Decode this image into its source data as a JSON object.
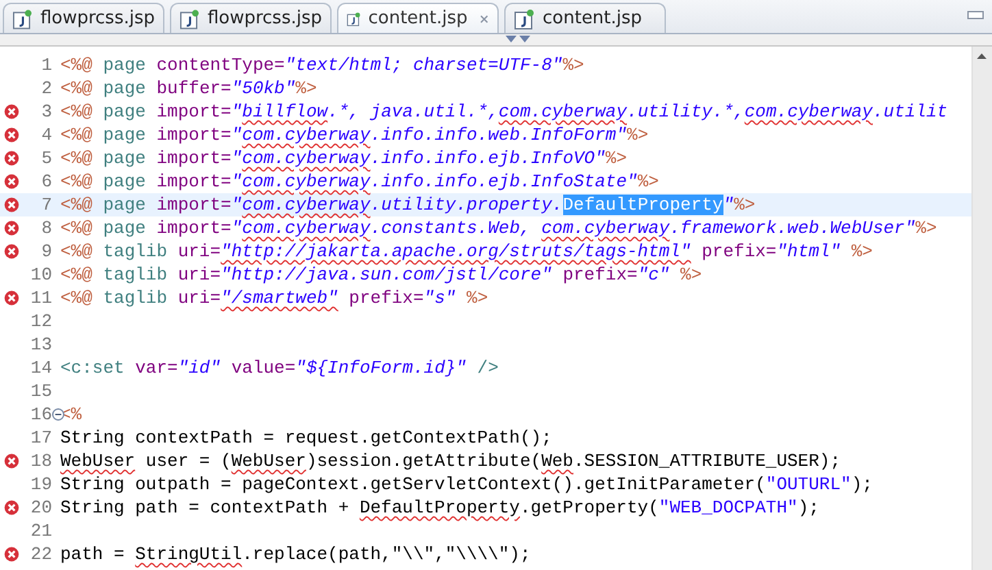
{
  "tabs": [
    {
      "label": "flowprcss.jsp",
      "selected": false
    },
    {
      "label": "flowprcss.jsp",
      "selected": false
    },
    {
      "label": "content.jsp",
      "selected": true
    },
    {
      "label": "content.jsp",
      "selected": false
    }
  ],
  "editor": {
    "lines": [
      {
        "number": "1",
        "error": false,
        "fold": false,
        "current": false,
        "tokens": [
          {
            "kind": "d",
            "text": "<%@ "
          },
          {
            "kind": "t",
            "text": "page "
          },
          {
            "kind": "a",
            "text": "contentType="
          },
          {
            "kind": "s",
            "text": "\"text/html; charset=UTF-8\""
          },
          {
            "kind": "d",
            "text": "%>"
          }
        ]
      },
      {
        "number": "2",
        "error": false,
        "fold": false,
        "current": false,
        "tokens": [
          {
            "kind": "d",
            "text": "<%@ "
          },
          {
            "kind": "t",
            "text": "page "
          },
          {
            "kind": "a",
            "text": "buffer="
          },
          {
            "kind": "s",
            "text": "\"50kb\""
          },
          {
            "kind": "d",
            "text": "%>"
          }
        ]
      },
      {
        "number": "3",
        "error": true,
        "fold": false,
        "current": false,
        "tokens": [
          {
            "kind": "d",
            "text": "<%@ "
          },
          {
            "kind": "t",
            "text": "page "
          },
          {
            "kind": "a",
            "text": "import="
          },
          {
            "kind": "s",
            "text": "\""
          },
          {
            "kind": "se",
            "text": "billflow"
          },
          {
            "kind": "s",
            "text": ".*, java.util.*,"
          },
          {
            "kind": "se",
            "text": "com.cyberway"
          },
          {
            "kind": "s",
            "text": ".utility.*,"
          },
          {
            "kind": "se",
            "text": "com.cyberway"
          },
          {
            "kind": "s",
            "text": ".utilit"
          }
        ]
      },
      {
        "number": "4",
        "error": true,
        "fold": false,
        "current": false,
        "tokens": [
          {
            "kind": "d",
            "text": "<%@ "
          },
          {
            "kind": "t",
            "text": "page "
          },
          {
            "kind": "a",
            "text": "import="
          },
          {
            "kind": "s",
            "text": "\""
          },
          {
            "kind": "se",
            "text": "com.cyberway"
          },
          {
            "kind": "s",
            "text": ".info.info.web.InfoForm\""
          },
          {
            "kind": "d",
            "text": "%>"
          }
        ]
      },
      {
        "number": "5",
        "error": true,
        "fold": false,
        "current": false,
        "tokens": [
          {
            "kind": "d",
            "text": "<%@ "
          },
          {
            "kind": "t",
            "text": "page "
          },
          {
            "kind": "a",
            "text": "import="
          },
          {
            "kind": "s",
            "text": "\""
          },
          {
            "kind": "se",
            "text": "com.cyberway"
          },
          {
            "kind": "s",
            "text": ".info.info.ejb.InfoVO\""
          },
          {
            "kind": "d",
            "text": "%>"
          }
        ]
      },
      {
        "number": "6",
        "error": true,
        "fold": false,
        "current": false,
        "tokens": [
          {
            "kind": "d",
            "text": "<%@ "
          },
          {
            "kind": "t",
            "text": "page "
          },
          {
            "kind": "a",
            "text": "import="
          },
          {
            "kind": "s",
            "text": "\""
          },
          {
            "kind": "se",
            "text": "com.cyberway"
          },
          {
            "kind": "s",
            "text": ".info.info.ejb.InfoState\""
          },
          {
            "kind": "d",
            "text": "%>"
          }
        ]
      },
      {
        "number": "7",
        "error": true,
        "fold": false,
        "current": true,
        "tokens": [
          {
            "kind": "d",
            "text": "<%@ "
          },
          {
            "kind": "t",
            "text": "page "
          },
          {
            "kind": "a",
            "text": "import="
          },
          {
            "kind": "s",
            "text": "\""
          },
          {
            "kind": "se",
            "text": "com.cyberway"
          },
          {
            "kind": "s",
            "text": ".utility.property."
          },
          {
            "kind": "sel",
            "text": "DefaultProperty"
          },
          {
            "kind": "s",
            "text": "\""
          },
          {
            "kind": "d",
            "text": "%>"
          }
        ]
      },
      {
        "number": "8",
        "error": true,
        "fold": false,
        "current": false,
        "tokens": [
          {
            "kind": "d",
            "text": "<%@ "
          },
          {
            "kind": "t",
            "text": "page "
          },
          {
            "kind": "a",
            "text": "import="
          },
          {
            "kind": "s",
            "text": "\""
          },
          {
            "kind": "se",
            "text": "com.cyberway"
          },
          {
            "kind": "s",
            "text": ".constants.Web, "
          },
          {
            "kind": "se",
            "text": "com.cyberway"
          },
          {
            "kind": "s",
            "text": ".framework.web.WebUser\""
          },
          {
            "kind": "d",
            "text": "%>"
          }
        ]
      },
      {
        "number": "9",
        "error": true,
        "fold": false,
        "current": false,
        "tokens": [
          {
            "kind": "d",
            "text": "<%@ "
          },
          {
            "kind": "t",
            "text": "taglib "
          },
          {
            "kind": "a",
            "text": "uri="
          },
          {
            "kind": "se",
            "text": "\"http://jakarta.apache.org/struts/tags-html\""
          },
          {
            "kind": "a",
            "text": " prefix="
          },
          {
            "kind": "s",
            "text": "\"html\" "
          },
          {
            "kind": "d",
            "text": "%>"
          }
        ]
      },
      {
        "number": "10",
        "error": false,
        "fold": false,
        "current": false,
        "tokens": [
          {
            "kind": "d",
            "text": "<%@ "
          },
          {
            "kind": "t",
            "text": "taglib "
          },
          {
            "kind": "a",
            "text": "uri="
          },
          {
            "kind": "s",
            "text": "\"http://java.sun.com/jstl/core\""
          },
          {
            "kind": "a",
            "text": " prefix="
          },
          {
            "kind": "s",
            "text": "\"c\" "
          },
          {
            "kind": "d",
            "text": "%>"
          }
        ]
      },
      {
        "number": "11",
        "error": true,
        "fold": false,
        "current": false,
        "tokens": [
          {
            "kind": "d",
            "text": "<%@ "
          },
          {
            "kind": "t",
            "text": "taglib "
          },
          {
            "kind": "a",
            "text": "uri="
          },
          {
            "kind": "se",
            "text": "\"/smartweb\""
          },
          {
            "kind": "a",
            "text": " prefix="
          },
          {
            "kind": "s",
            "text": "\"s\" "
          },
          {
            "kind": "d",
            "text": "%>"
          }
        ]
      },
      {
        "number": "12",
        "error": false,
        "fold": false,
        "current": false
      },
      {
        "number": "13",
        "error": false,
        "fold": false,
        "current": false
      },
      {
        "number": "14",
        "error": false,
        "fold": false,
        "current": false,
        "tokens": [
          {
            "kind": "t",
            "text": "<c:set "
          },
          {
            "kind": "a",
            "text": "var="
          },
          {
            "kind": "s",
            "text": "\"id\" "
          },
          {
            "kind": "a",
            "text": "value="
          },
          {
            "kind": "s",
            "text": "\"${InfoForm.id}\" "
          },
          {
            "kind": "t",
            "text": "/>"
          }
        ]
      },
      {
        "number": "15",
        "error": false,
        "fold": false,
        "current": false
      },
      {
        "number": "16",
        "error": false,
        "fold": true,
        "current": false,
        "tokens": [
          {
            "kind": "d",
            "text": "<%"
          }
        ]
      },
      {
        "number": "17",
        "error": false,
        "fold": false,
        "current": false,
        "tokens": [
          {
            "kind": "c",
            "text": "String contextPath = request.getContextPath();"
          }
        ]
      },
      {
        "number": "18",
        "error": true,
        "fold": false,
        "current": false,
        "tokens": [
          {
            "kind": "ce",
            "text": "WebUser"
          },
          {
            "kind": "c",
            "text": " user = ("
          },
          {
            "kind": "ce",
            "text": "WebUser"
          },
          {
            "kind": "c",
            "text": ")session.getAttribute("
          },
          {
            "kind": "ce",
            "text": "Web"
          },
          {
            "kind": "c",
            "text": ".SESSION_ATTRIBUTE_USER);"
          }
        ]
      },
      {
        "number": "19",
        "error": false,
        "fold": false,
        "current": false,
        "tokens": [
          {
            "kind": "c",
            "text": "String outpath = pageContext.getServletContext().getInitParameter("
          },
          {
            "kind": "l",
            "text": "\"OUTURL\""
          },
          {
            "kind": "c",
            "text": ");"
          }
        ]
      },
      {
        "number": "20",
        "error": true,
        "fold": false,
        "current": false,
        "tokens": [
          {
            "kind": "c",
            "text": "String path = contextPath + "
          },
          {
            "kind": "ce",
            "text": "DefaultProperty"
          },
          {
            "kind": "c",
            "text": ".getProperty("
          },
          {
            "kind": "l",
            "text": "\"WEB_DOCPATH\""
          },
          {
            "kind": "c",
            "text": ");"
          }
        ]
      },
      {
        "number": "21",
        "error": false,
        "fold": false,
        "current": false
      },
      {
        "number": "22",
        "error": true,
        "fold": false,
        "current": false,
        "tokens": [
          {
            "kind": "c",
            "text": "path = "
          },
          {
            "kind": "ce",
            "text": "StringUtil"
          },
          {
            "kind": "c",
            "text": ".replace(path,\"\\\\\",\"\\\\\\\\\");"
          }
        ]
      }
    ]
  }
}
